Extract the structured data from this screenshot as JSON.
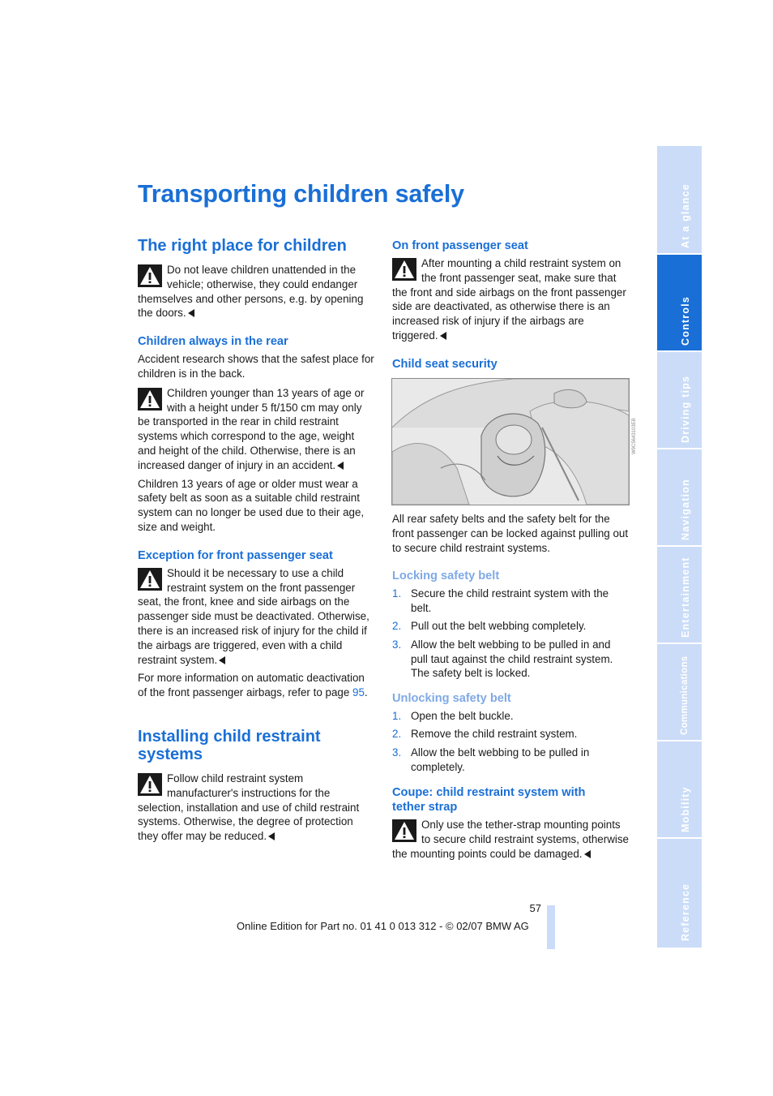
{
  "page": {
    "title": "Transporting children safely",
    "page_number": "57",
    "footer": "Online Edition for Part no. 01 41 0 013 312 - © 02/07 BMW AG"
  },
  "sidebar": {
    "tabs": [
      {
        "label": "At a glance",
        "active": false
      },
      {
        "label": "Controls",
        "active": true
      },
      {
        "label": "Driving tips",
        "active": false
      },
      {
        "label": "Navigation",
        "active": false
      },
      {
        "label": "Entertainment",
        "active": false
      },
      {
        "label": "Communications",
        "active": false
      },
      {
        "label": "Mobility",
        "active": false
      },
      {
        "label": "Reference",
        "active": false
      }
    ]
  },
  "left": {
    "right_place": {
      "heading": "The right place for children",
      "warning": "Do not leave children unattended in the vehicle; otherwise, they could endanger themselves and other persons, e.g. by opening the doors."
    },
    "rear": {
      "heading": "Children always in the rear",
      "text": "Accident research shows that the safest place for children is in the back.",
      "warning": "Children younger than 13 years of age or with a height under 5 ft/150 cm may only be transported in the rear in child restraint systems which correspond to the age, weight and height of the child. Otherwise, there is an increased danger of injury in an accident.",
      "text2": "Children 13 years of age or older must wear a safety belt as soon as a suitable child restraint system can no longer be used due to their age, size and weight."
    },
    "exception": {
      "heading": "Exception for front passenger seat",
      "warning": "Should it be necessary to use a child restraint system on the front passenger seat, the front, knee and side airbags on the passenger side must be deactivated. Otherwise, there is an increased risk of injury for the child if the airbags are triggered, even with a child restraint system.",
      "text_before": "For more information on automatic deactivation of the front passenger airbags, refer to page ",
      "page_link": "95",
      "text_after": "."
    },
    "installing": {
      "heading": "Installing child restraint systems",
      "warning": "Follow child restraint system manufacturer's instructions for the selection, installation and use of child restraint systems. Otherwise, the degree of protection they offer may be reduced."
    }
  },
  "right": {
    "front_seat": {
      "heading": "On front passenger seat",
      "warning": "After mounting a child restraint system on the front passenger seat, make sure that the front and side airbags on the front passenger side are deactivated, as otherwise there is an increased risk of injury if the airbags are triggered."
    },
    "security": {
      "heading": "Child seat security",
      "figure_alt": "Child restraint system installed in rear seat",
      "figure_code": "W9C5643103EB",
      "text": "All rear safety belts and the safety belt for the front passenger can be locked against pulling out to secure child restraint systems."
    },
    "locking": {
      "heading": "Locking safety belt",
      "steps": [
        {
          "num": "1.",
          "text": "Secure the child restraint system with the belt."
        },
        {
          "num": "2.",
          "text": "Pull out the belt webbing completely."
        },
        {
          "num": "3.",
          "text": "Allow the belt webbing to be pulled in and pull taut against the child restraint system. The safety belt is locked."
        }
      ]
    },
    "unlocking": {
      "heading": "Unlocking safety belt",
      "steps": [
        {
          "num": "1.",
          "text": "Open the belt buckle."
        },
        {
          "num": "2.",
          "text": "Remove the child restraint system."
        },
        {
          "num": "3.",
          "text": "Allow the belt webbing to be pulled in completely."
        }
      ]
    },
    "coupe": {
      "heading": "Coupe: child restraint system with tether strap",
      "warning": "Only use the tether-strap mounting points to secure child restraint systems, otherwise the mounting points could be damaged."
    }
  }
}
